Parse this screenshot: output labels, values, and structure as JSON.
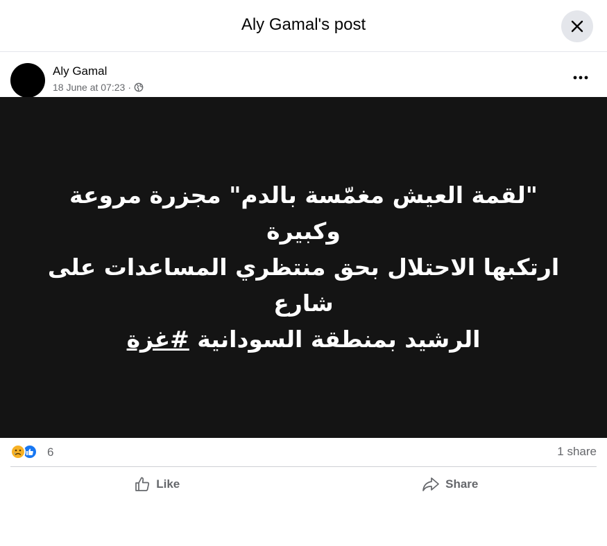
{
  "header": {
    "title": "Aly Gamal's post"
  },
  "author": {
    "name": "Aly Gamal",
    "timestamp": "18 June at 07:23",
    "separator": "·",
    "privacy_icon": "globe-icon"
  },
  "post": {
    "line1": "\"لقمة العيش مغمّسة بالدم\" مجزرة مروعة وكبيرة",
    "line2": "ارتكبها الاحتلال بحق منتظري المساعدات على شارع",
    "line3_text": "الرشيد بمنطقة السودانية ",
    "hashtag": "#غزة",
    "background_color": "#141414"
  },
  "stats": {
    "reaction_count": "6",
    "share_count": "1 share",
    "reaction_icons": [
      "sad-reaction-icon",
      "like-reaction-icon"
    ]
  },
  "actions": {
    "like_label": "Like",
    "share_label": "Share"
  },
  "colors": {
    "like_blue": "#1877f2",
    "sad_yellow": "#f7b125",
    "secondary_text": "#65676b",
    "close_bg": "#e4e6eb"
  }
}
